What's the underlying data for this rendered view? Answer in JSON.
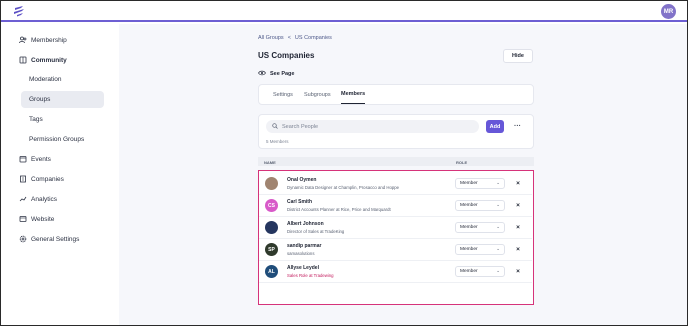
{
  "header": {
    "logo_icon": "stripes-logo-icon",
    "user_initials": "MR",
    "user_avatar_color": "#8273c9"
  },
  "sidebar": {
    "items": [
      {
        "label": "Membership",
        "icon": "users-icon"
      },
      {
        "label": "Community",
        "icon": "book-icon"
      },
      {
        "label": "Moderation"
      },
      {
        "label": "Groups"
      },
      {
        "label": "Tags"
      },
      {
        "label": "Permission Groups"
      },
      {
        "label": "Events",
        "icon": "calendar-icon"
      },
      {
        "label": "Companies",
        "icon": "building-icon"
      },
      {
        "label": "Analytics",
        "icon": "chart-icon"
      },
      {
        "label": "Website",
        "icon": "globe-icon"
      },
      {
        "label": "General Settings",
        "icon": "gear-icon"
      }
    ]
  },
  "breadcrumb": {
    "root": "All Groups",
    "sep": "<",
    "current": "US Companies"
  },
  "page": {
    "title": "US Companies",
    "hide_label": "Hide",
    "see_page_label": "See Page"
  },
  "tabs": [
    {
      "label": "Settings"
    },
    {
      "label": "Subgroups"
    },
    {
      "label": "Members",
      "active": true
    }
  ],
  "search": {
    "placeholder": "Search People",
    "add_label": "Add",
    "more_label": "···",
    "count_text": "5 Members"
  },
  "table": {
    "col_name": "NAME",
    "col_role": "ROLE"
  },
  "members": [
    {
      "name": "Onal Oymen",
      "title": "Dynamic Data Designer at Champlin, Prosacco and Hoppe",
      "initials": "",
      "avatar_color": "#a08470",
      "role": "Member"
    },
    {
      "name": "Carl Smith",
      "title": "District Accounts Planner at Rice, Price and Marquardt",
      "initials": "CS",
      "avatar_color": "#d85ac9",
      "role": "Member"
    },
    {
      "name": "Albert Johnson",
      "title": "Director of Sales at TradeKing",
      "initials": "",
      "avatar_color": "#25365f",
      "role": "Member"
    },
    {
      "name": "sandip parmar",
      "title": "samasolutions",
      "initials": "SP",
      "avatar_color": "#2f3a2c",
      "role": "Member"
    },
    {
      "name": "Allyse Leydel",
      "title": "Sales Role at Tradewing",
      "initials": "AL",
      "avatar_color": "#1f4d7a",
      "role": "Member",
      "title_color": "#c2185b"
    }
  ],
  "remove_label": "×",
  "role_chevron": "⌄",
  "colors": {
    "accent": "#6657d8",
    "highlight": "#d6337a"
  }
}
